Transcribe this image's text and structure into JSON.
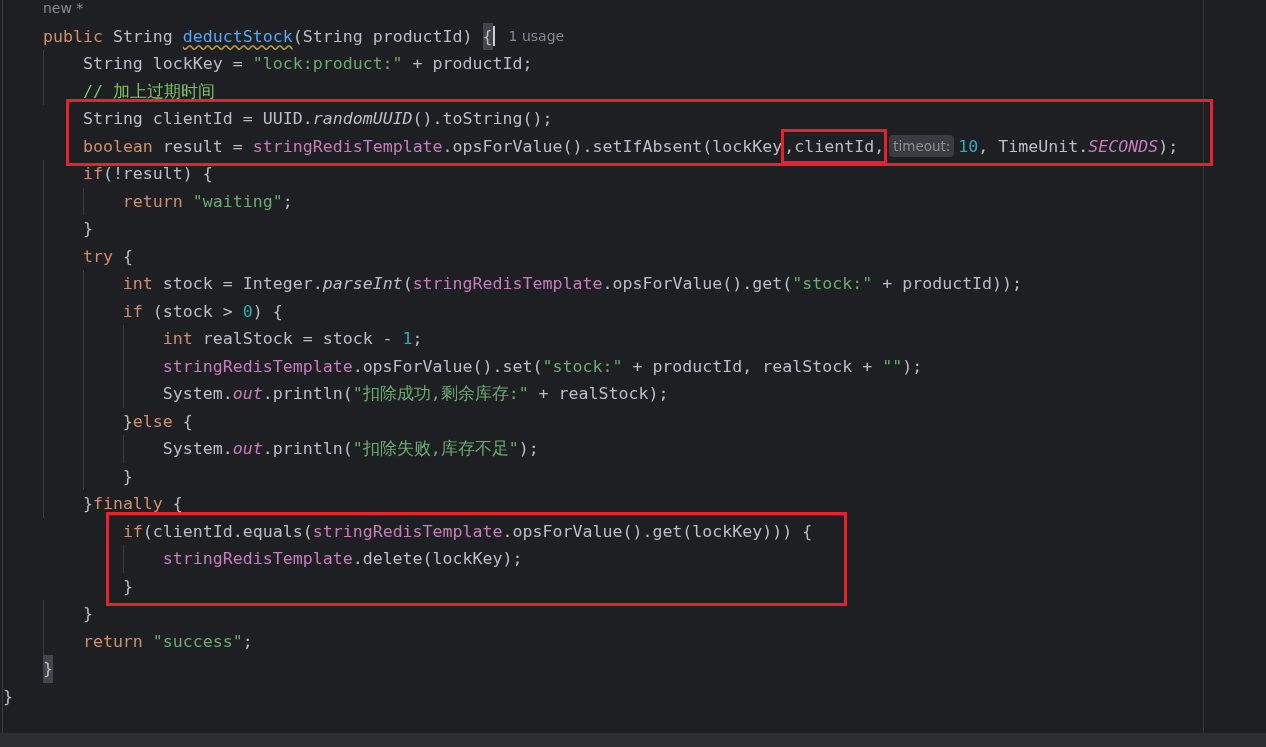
{
  "editor": {
    "code": {
      "body": [
        {
          "kind": "line",
          "tokens": [
            {
              "kind": "usage",
              "text": "new *"
            }
          ]
        },
        {
          "kind": "line",
          "tokens": [
            {
              "kind": "kw",
              "text": "public "
            },
            {
              "kind": "p",
              "text": "String "
            },
            {
              "kind": "decl",
              "text": "deductStock"
            },
            {
              "kind": "p",
              "text": "(String productId) "
            },
            {
              "kind": "bracket",
              "text": "{"
            },
            {
              "kind": "caret"
            },
            {
              "kind": "usage",
              "text": "1 usage"
            }
          ],
          "children": [
            {
              "kind": "line",
              "tokens": [
                {
                  "kind": "p",
                  "text": "String lockKey = "
                },
                {
                  "kind": "str",
                  "text": "\"lock:product:\""
                },
                {
                  "kind": "p",
                  "text": " + productId;"
                }
              ]
            },
            {
              "kind": "line",
              "tokens": [
                {
                  "kind": "cm",
                  "text": "// 加上过期时间"
                }
              ]
            },
            {
              "kind": "marked",
              "lines": [
                {
                  "kind": "line",
                  "tokens": [
                    {
                      "kind": "p",
                      "text": "String clientId = UUID."
                    },
                    {
                      "kind": "it",
                      "text": "randomUUID"
                    },
                    {
                      "kind": "p",
                      "text": "().toString();"
                    }
                  ]
                },
                {
                  "kind": "line",
                  "tokens": [
                    {
                      "kind": "kw",
                      "text": "boolean "
                    },
                    {
                      "kind": "p",
                      "text": "result = "
                    },
                    {
                      "kind": "fld",
                      "text": "stringRedisTemplate"
                    },
                    {
                      "kind": "p",
                      "text": ".opsForValue().setIfAbsent(lockKey"
                    },
                    {
                      "kind": "marked",
                      "text": ",clientId,"
                    },
                    {
                      "kind": "hint",
                      "text": "timeout:"
                    },
                    {
                      "kind": "num",
                      "text": "10"
                    },
                    {
                      "kind": "p",
                      "text": ", TimeUnit."
                    },
                    {
                      "kind": "fldi",
                      "text": "SECONDS"
                    },
                    {
                      "kind": "p",
                      "text": ");"
                    }
                  ]
                }
              ]
            },
            {
              "kind": "line",
              "tokens": [
                {
                  "kind": "kw",
                  "text": "if"
                },
                {
                  "kind": "p",
                  "text": "(!result) {"
                }
              ],
              "children": [
                {
                  "kind": "line",
                  "tokens": [
                    {
                      "kind": "kw",
                      "text": "return "
                    },
                    {
                      "kind": "str",
                      "text": "\"waiting\""
                    },
                    {
                      "kind": "p",
                      "text": ";"
                    }
                  ]
                }
              ]
            },
            {
              "kind": "line",
              "tokens": [
                {
                  "kind": "p",
                  "text": "}"
                }
              ]
            },
            {
              "kind": "line",
              "tokens": [
                {
                  "kind": "kw",
                  "text": "try "
                },
                {
                  "kind": "p",
                  "text": "{"
                }
              ],
              "children": [
                {
                  "kind": "line",
                  "tokens": [
                    {
                      "kind": "kw",
                      "text": "int "
                    },
                    {
                      "kind": "p",
                      "text": "stock = Integer."
                    },
                    {
                      "kind": "it",
                      "text": "parseInt"
                    },
                    {
                      "kind": "p",
                      "text": "("
                    },
                    {
                      "kind": "fld",
                      "text": "stringRedisTemplate"
                    },
                    {
                      "kind": "p",
                      "text": ".opsForValue().get("
                    },
                    {
                      "kind": "str",
                      "text": "\"stock:\""
                    },
                    {
                      "kind": "p",
                      "text": " + productId));"
                    }
                  ]
                },
                {
                  "kind": "line",
                  "tokens": [
                    {
                      "kind": "kw",
                      "text": "if "
                    },
                    {
                      "kind": "p",
                      "text": "(stock > "
                    },
                    {
                      "kind": "num",
                      "text": "0"
                    },
                    {
                      "kind": "p",
                      "text": ") {"
                    }
                  ],
                  "children": [
                    {
                      "kind": "line",
                      "tokens": [
                        {
                          "kind": "kw",
                          "text": "int "
                        },
                        {
                          "kind": "p",
                          "text": "realStock = stock - "
                        },
                        {
                          "kind": "num",
                          "text": "1"
                        },
                        {
                          "kind": "p",
                          "text": ";"
                        }
                      ]
                    },
                    {
                      "kind": "line",
                      "tokens": [
                        {
                          "kind": "fld",
                          "text": "stringRedisTemplate"
                        },
                        {
                          "kind": "p",
                          "text": ".opsForValue().set("
                        },
                        {
                          "kind": "str",
                          "text": "\"stock:\""
                        },
                        {
                          "kind": "p",
                          "text": " + productId, realStock + "
                        },
                        {
                          "kind": "str",
                          "text": "\"\""
                        },
                        {
                          "kind": "p",
                          "text": ");"
                        }
                      ]
                    },
                    {
                      "kind": "line",
                      "tokens": [
                        {
                          "kind": "p",
                          "text": "System."
                        },
                        {
                          "kind": "fldi",
                          "text": "out"
                        },
                        {
                          "kind": "p",
                          "text": ".println("
                        },
                        {
                          "kind": "str",
                          "text": "\"扣除成功,剩余库存:\""
                        },
                        {
                          "kind": "p",
                          "text": " + realStock);"
                        }
                      ]
                    }
                  ]
                },
                {
                  "kind": "line",
                  "tokens": [
                    {
                      "kind": "p",
                      "text": "}"
                    },
                    {
                      "kind": "kw",
                      "text": "else "
                    },
                    {
                      "kind": "p",
                      "text": "{"
                    }
                  ],
                  "children": [
                    {
                      "kind": "line",
                      "tokens": [
                        {
                          "kind": "p",
                          "text": "System."
                        },
                        {
                          "kind": "fldi",
                          "text": "out"
                        },
                        {
                          "kind": "p",
                          "text": ".println("
                        },
                        {
                          "kind": "str",
                          "text": "\"扣除失败,库存不足\""
                        },
                        {
                          "kind": "p",
                          "text": ");"
                        }
                      ]
                    }
                  ]
                },
                {
                  "kind": "line",
                  "tokens": [
                    {
                      "kind": "p",
                      "text": "}"
                    }
                  ]
                }
              ]
            },
            {
              "kind": "line",
              "tokens": [
                {
                  "kind": "p",
                  "text": "}"
                },
                {
                  "kind": "kw",
                  "text": "finally "
                },
                {
                  "kind": "p",
                  "text": "{"
                }
              ],
              "children": [
                {
                  "kind": "marked",
                  "lines": [
                    {
                      "kind": "line",
                      "tokens": [
                        {
                          "kind": "kw",
                          "text": "if"
                        },
                        {
                          "kind": "p",
                          "text": "(clientId.equals("
                        },
                        {
                          "kind": "fld",
                          "text": "stringRedisTemplate"
                        },
                        {
                          "kind": "p",
                          "text": ".opsForValue().get(lockKey))) {"
                        }
                      ],
                      "children": [
                        {
                          "kind": "line",
                          "tokens": [
                            {
                              "kind": "fld",
                              "text": "stringRedisTemplate"
                            },
                            {
                              "kind": "p",
                              "text": ".delete(lockKey);"
                            }
                          ]
                        }
                      ]
                    },
                    {
                      "kind": "line",
                      "tokens": [
                        {
                          "kind": "p",
                          "text": "}"
                        }
                      ]
                    }
                  ]
                }
              ]
            },
            {
              "kind": "line",
              "tokens": [
                {
                  "kind": "p",
                  "text": "}"
                }
              ]
            },
            {
              "kind": "line",
              "tokens": [
                {
                  "kind": "kw",
                  "text": "return "
                },
                {
                  "kind": "str",
                  "text": "\"success\""
                },
                {
                  "kind": "p",
                  "text": ";"
                }
              ]
            }
          ]
        },
        {
          "kind": "line",
          "tokens": [
            {
              "kind": "bracket",
              "text": "}"
            }
          ]
        }
      ],
      "end": [
        {
          "kind": "line",
          "tokens": [
            {
              "kind": "p",
              "text": "}"
            }
          ]
        }
      ]
    }
  }
}
